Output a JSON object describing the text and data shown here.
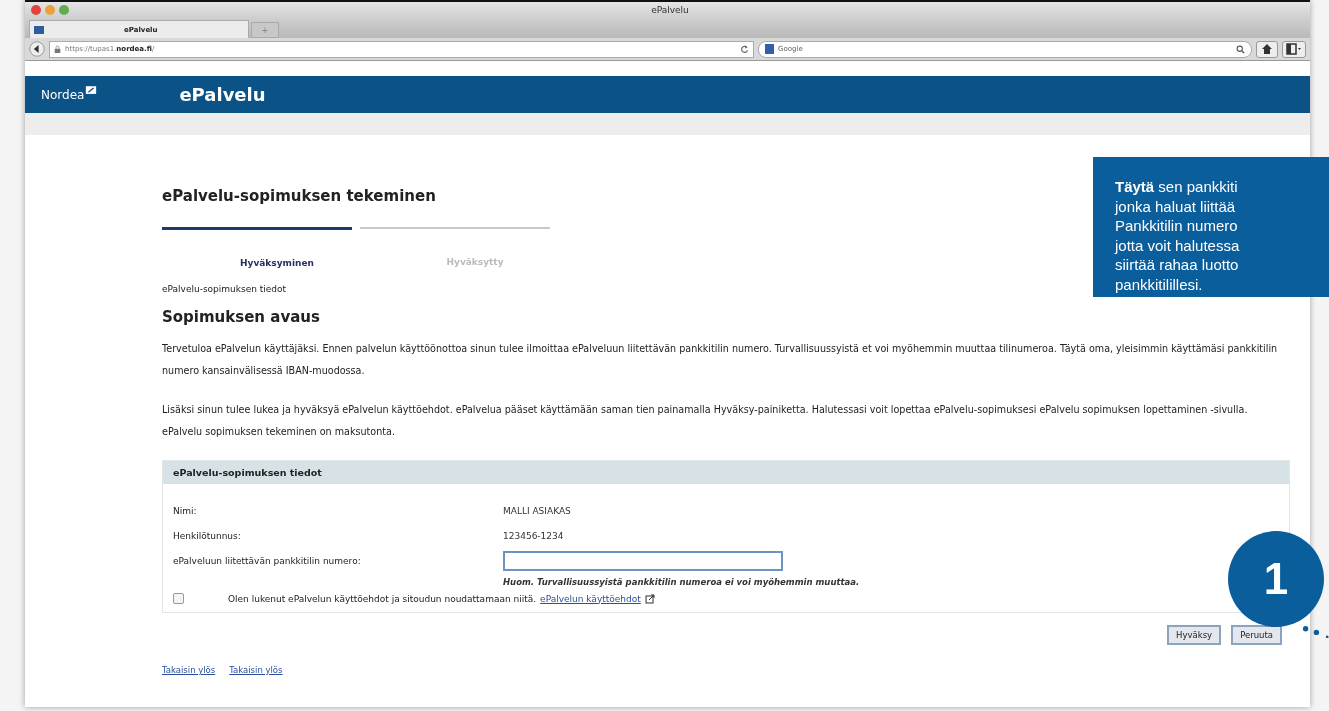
{
  "window": {
    "title": "ePalvelu"
  },
  "tabs": [
    {
      "label": "ePalvelu",
      "selected": true
    }
  ],
  "new_tab": "+",
  "address_bar": {
    "url_prefix": "https://tupas1.",
    "url_domain": "nordea.fi",
    "url_suffix": "/"
  },
  "search": {
    "engine_label": "Google"
  },
  "site_header": {
    "logo": "Nordea",
    "title": "ePalvelu"
  },
  "page_title": "ePalvelu-sopimuksen tekeminen",
  "steps": [
    {
      "label": "Hyväksyminen",
      "selected": true
    },
    {
      "label": "Hyväksytty",
      "selected": false
    }
  ],
  "breadcrumb": "ePalvelu-sopimuksen tiedot",
  "section_title": "Sopimuksen avaus",
  "paragraphs": [
    "Tervetuloa ePalvelun käyttäjäksi. Ennen palvelun käyttöönottoa sinun tulee ilmoittaa ePalveluun liitettävän pankkitilin numero. Turvallisuussyistä et voi myöhemmin muuttaa tilinumeroa. Täytä oma, yleisimmin käyttämäsi pankkitilin numero kansainvälisessä IBAN-muodossa.",
    "Lisäksi sinun tulee lukea ja hyväksyä ePalvelun käyttöehdot. ePalvelua pääset käyttämään saman tien painamalla Hyväksy-painiketta. Halutessasi voit lopettaa ePalvelu-sopimuksesi ePalvelu sopimuksen lopettaminen -sivulla. ePalvelu sopimuksen tekeminen on maksutonta."
  ],
  "form": {
    "title": "ePalvelu-sopimuksen tiedot",
    "rows": [
      {
        "label": "Nimi:",
        "value": "MALLI ASIAKAS"
      },
      {
        "label": "Henkilötunnus:",
        "value": "123456-1234"
      }
    ],
    "account_field": {
      "label": "ePalveluun liitettävän pankkitilin numero:",
      "note": "Huom. Turvallisuussyistä pankkitilin numeroa ei voi myöhemmin muuttaa."
    },
    "terms": {
      "checked": false,
      "text": "Olen lukenut ePalvelun käyttöehdot ja sitoudun noudattamaan niitä.",
      "link": "ePalvelun käyttöehdot"
    }
  },
  "buttons": [
    "Hyväksy",
    "Peruuta"
  ],
  "footer_links": [
    "Takaisin ylös",
    "Takaisin ylös"
  ],
  "callout": {
    "lines": [
      "**Täytä** sen pankkiti",
      "jonka haluat liittää",
      "Pankkitilin numero",
      "jotta voit halutessa",
      "siirtää rahaa luotto",
      "pankkitilillesi."
    ],
    "step_number": "1"
  }
}
